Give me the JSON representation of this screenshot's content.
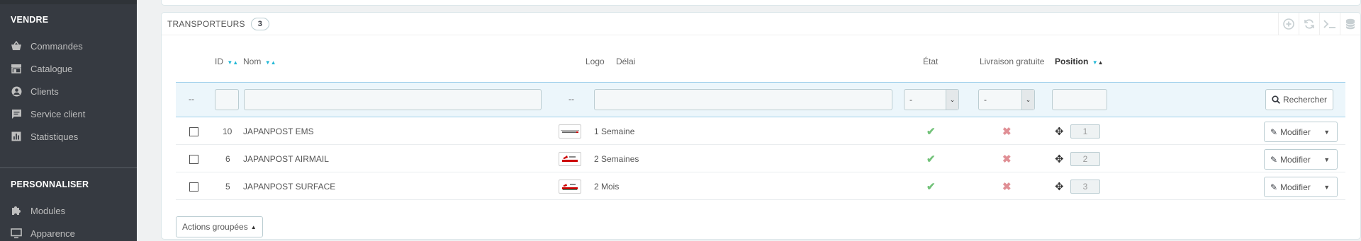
{
  "sidebar": {
    "section_sell": "VENDRE",
    "items_sell": [
      {
        "label": "Commandes",
        "icon": "basket-icon"
      },
      {
        "label": "Catalogue",
        "icon": "store-icon"
      },
      {
        "label": "Clients",
        "icon": "account-icon"
      },
      {
        "label": "Service client",
        "icon": "chat-icon"
      },
      {
        "label": "Statistiques",
        "icon": "chart-icon"
      }
    ],
    "section_customize": "PERSONNALISER",
    "items_customize": [
      {
        "label": "Modules",
        "icon": "puzzle-icon"
      },
      {
        "label": "Apparence",
        "icon": "desktop-icon"
      }
    ]
  },
  "panel": {
    "title": "TRANSPORTEURS",
    "count": "3",
    "toolbar_icons": [
      "add-icon",
      "refresh-icon",
      "terminal-icon",
      "database-icon"
    ]
  },
  "table": {
    "headers": {
      "id": "ID",
      "name": "Nom",
      "logo": "Logo",
      "delay": "Délai",
      "status": "État",
      "free_shipping": "Livraison gratuite",
      "position": "Position"
    },
    "filter": {
      "dash_checkbox": "--",
      "dash_logo": "--",
      "status_select": "-",
      "free_select": "-",
      "search_button": "Rechercher"
    },
    "rows": [
      {
        "id": "10",
        "name": "JAPANPOST EMS",
        "delay": "1 Semaine",
        "active": true,
        "free": false,
        "position": "1",
        "edit": "Modifier"
      },
      {
        "id": "6",
        "name": "JAPANPOST AIRMAIL",
        "delay": "2 Semaines",
        "active": true,
        "free": false,
        "position": "2",
        "edit": "Modifier"
      },
      {
        "id": "5",
        "name": "JAPANPOST SURFACE",
        "delay": "2 Mois",
        "active": true,
        "free": false,
        "position": "3",
        "edit": "Modifier"
      }
    ],
    "bulk_actions": "Actions groupées"
  },
  "colors": {
    "sidebar_bg": "#363a41",
    "accent": "#25b9d7",
    "check_green": "#72c279",
    "cross_red": "#e08f95"
  }
}
